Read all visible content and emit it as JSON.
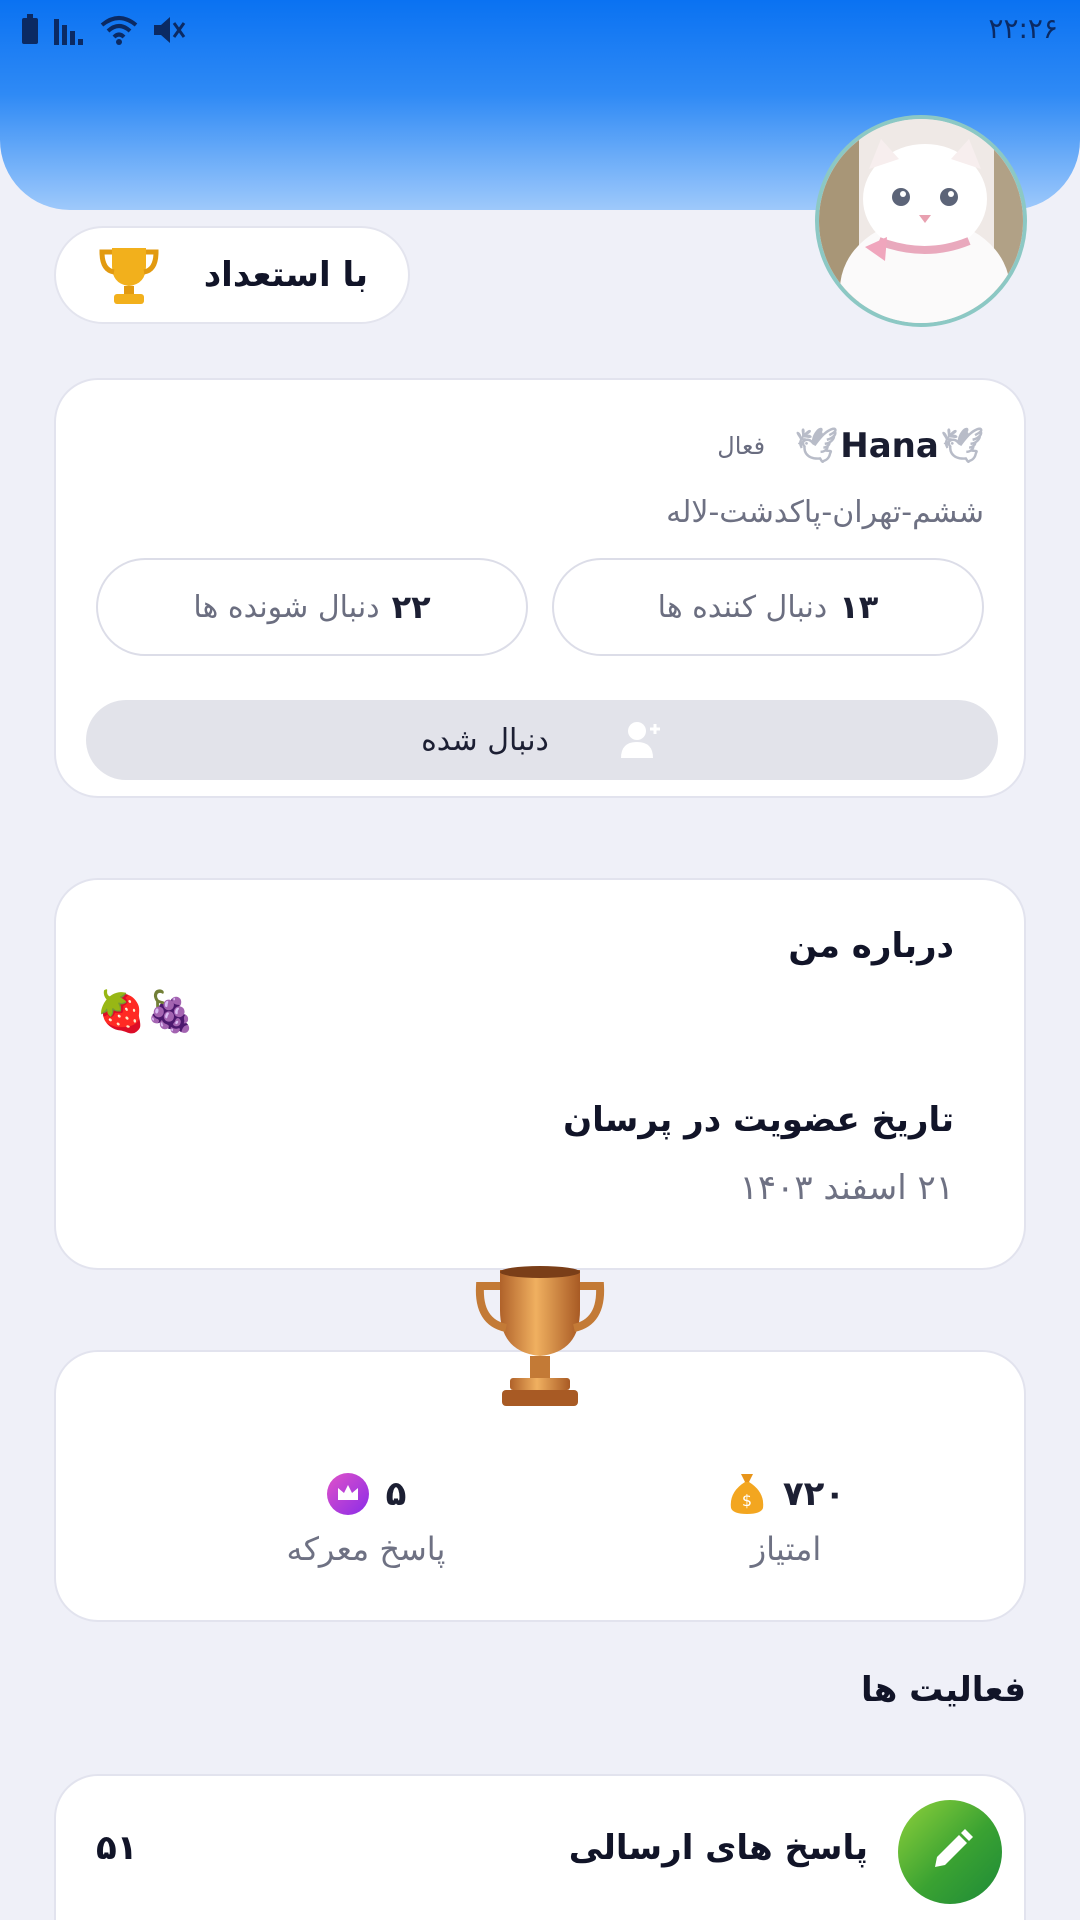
{
  "status_bar": {
    "time": "۲۲:۲۶"
  },
  "badge": {
    "label": "با استعداد",
    "icon": "trophy-icon"
  },
  "profile": {
    "status": "فعال",
    "username": "Hana",
    "location": "ششم-تهران-پاکدشت-لاله",
    "followers": {
      "count": "۱۳",
      "label": "دنبال کننده ها"
    },
    "following": {
      "count": "۲۲",
      "label": "دنبال شونده ها"
    },
    "follow_button": {
      "label": "دنبال شده",
      "icon": "user-plus-icon"
    }
  },
  "about": {
    "title": "درباره من",
    "bio": "🍓🍇",
    "join_title": "تاریخ عضویت در پرسان",
    "join_date": "۲۱ اسفند ۱۴۰۳"
  },
  "scores": {
    "points": {
      "value": "۷۲۰",
      "label": "امتیاز",
      "icon": "money-bag-icon"
    },
    "battle_answers": {
      "value": "۵",
      "label": "پاسخ معرکه",
      "icon": "crown-icon"
    }
  },
  "activities": {
    "title": "فعالیت ها",
    "items": [
      {
        "label": "پاسخ های ارسالی",
        "count": "۵۱",
        "icon": "pencil-icon"
      }
    ]
  },
  "colors": {
    "header_blue": "#0a72f2",
    "accent_green": "#3aa232",
    "crown_purple": "#b33ce0",
    "bag_orange": "#f0a020"
  }
}
